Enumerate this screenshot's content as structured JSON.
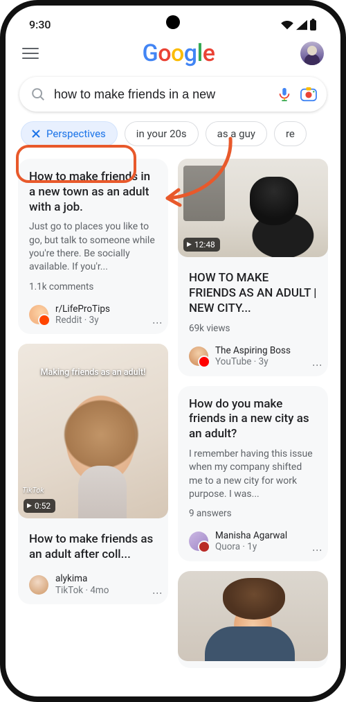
{
  "status": {
    "time": "9:30"
  },
  "logo": {
    "g1": "G",
    "o1": "o",
    "o2": "o",
    "g2": "g",
    "l": "l",
    "e": "e"
  },
  "search": {
    "query": "how to make friends in a new"
  },
  "chips": {
    "active_label": "Perspectives",
    "c1": "in your 20s",
    "c2": "as a guy",
    "c3": "re"
  },
  "cards": {
    "reddit": {
      "title": "How to make friends in a new town as an adult with a job.",
      "body": "Just go to places you like to go, but talk to someone while you're there. Be socially available. If you'r...",
      "meta": "1.1k comments",
      "author": "r/LifeProTips",
      "source": "Reddit · 3y"
    },
    "youtube": {
      "duration": "12:48",
      "title": "HOW TO MAKE FRIENDS AS AN ADULT | NEW CITY...",
      "meta": "69k views",
      "author": "The Aspiring Boss",
      "source": "YouTube · 3y"
    },
    "tiktok": {
      "overlay": "Making friends as an adult!",
      "watermark": "TikTok",
      "duration": "0:52",
      "title": "How to make friends as an adult after coll...",
      "author": "alykima",
      "source": "TikTok · 4mo"
    },
    "quora": {
      "title": "How do you make friends in a new city as an adult?",
      "body": "I remember having this issue when my company shifted me to a new city for work purpose. I was...",
      "meta": "9 answers",
      "author": "Manisha Agarwal",
      "source": "Quora · 1y"
    }
  }
}
